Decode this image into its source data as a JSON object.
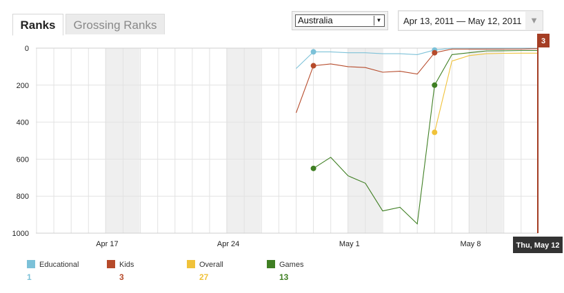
{
  "tabs": [
    {
      "label": "Ranks",
      "active": true
    },
    {
      "label": "Grossing Ranks",
      "active": false
    }
  ],
  "country_select": {
    "value": "Australia"
  },
  "date_range": {
    "label": "Apr 13, 2011 — May 12, 2011",
    "dropdown_icon": "triangle-down-icon"
  },
  "colors": {
    "educational": "#7cc1d8",
    "kids": "#b64a2a",
    "overall": "#f0c23a",
    "games": "#3f7f23",
    "marker": "#a53e24"
  },
  "legend": [
    {
      "name": "Educational",
      "value": "1",
      "color": "#7cc1d8"
    },
    {
      "name": "Kids",
      "value": "3",
      "color": "#b64a2a"
    },
    {
      "name": "Overall",
      "value": "27",
      "color": "#f0c23a"
    },
    {
      "name": "Games",
      "value": "13",
      "color": "#3f7f23"
    }
  ],
  "current_marker": {
    "badge": "3",
    "date_label": "Thu, May 12"
  },
  "chart_data": {
    "type": "line",
    "x": [
      "Apr 13",
      "Apr 14",
      "Apr 15",
      "Apr 16",
      "Apr 17",
      "Apr 18",
      "Apr 19",
      "Apr 20",
      "Apr 21",
      "Apr 22",
      "Apr 23",
      "Apr 24",
      "Apr 25",
      "Apr 26",
      "Apr 27",
      "Apr 28",
      "Apr 29",
      "Apr 30",
      "May 1",
      "May 2",
      "May 3",
      "May 4",
      "May 5",
      "May 6",
      "May 7",
      "May 8",
      "May 9",
      "May 10",
      "May 11",
      "May 12"
    ],
    "x_ticks": [
      "Apr 17",
      "Apr 24",
      "May 1",
      "May 8"
    ],
    "ylim": [
      1000,
      0
    ],
    "y_ticks": [
      0,
      200,
      400,
      600,
      800,
      1000
    ],
    "grid": true,
    "legend_position": "bottom",
    "series": [
      {
        "name": "Educational",
        "values": [
          null,
          null,
          null,
          null,
          null,
          null,
          null,
          null,
          null,
          null,
          null,
          null,
          null,
          null,
          null,
          110,
          20,
          20,
          25,
          25,
          30,
          30,
          35,
          10,
          0,
          0,
          0,
          0,
          0,
          1
        ],
        "dots": [
          16,
          23
        ]
      },
      {
        "name": "Kids",
        "values": [
          null,
          null,
          null,
          null,
          null,
          null,
          null,
          null,
          null,
          null,
          null,
          null,
          null,
          null,
          null,
          350,
          95,
          85,
          100,
          105,
          130,
          125,
          140,
          25,
          5,
          5,
          5,
          5,
          5,
          3
        ],
        "dots": [
          16,
          23
        ]
      },
      {
        "name": "Overall",
        "values": [
          null,
          null,
          null,
          null,
          null,
          null,
          null,
          null,
          null,
          null,
          null,
          null,
          null,
          null,
          null,
          null,
          null,
          null,
          null,
          null,
          null,
          null,
          null,
          455,
          70,
          40,
          30,
          28,
          27,
          27
        ],
        "dots": [
          23
        ]
      },
      {
        "name": "Games",
        "values": [
          null,
          null,
          null,
          null,
          null,
          null,
          null,
          null,
          null,
          null,
          null,
          null,
          null,
          null,
          null,
          null,
          650,
          590,
          690,
          730,
          880,
          860,
          950,
          200,
          35,
          25,
          15,
          14,
          13,
          13
        ],
        "dots": [
          16,
          23
        ]
      }
    ]
  }
}
